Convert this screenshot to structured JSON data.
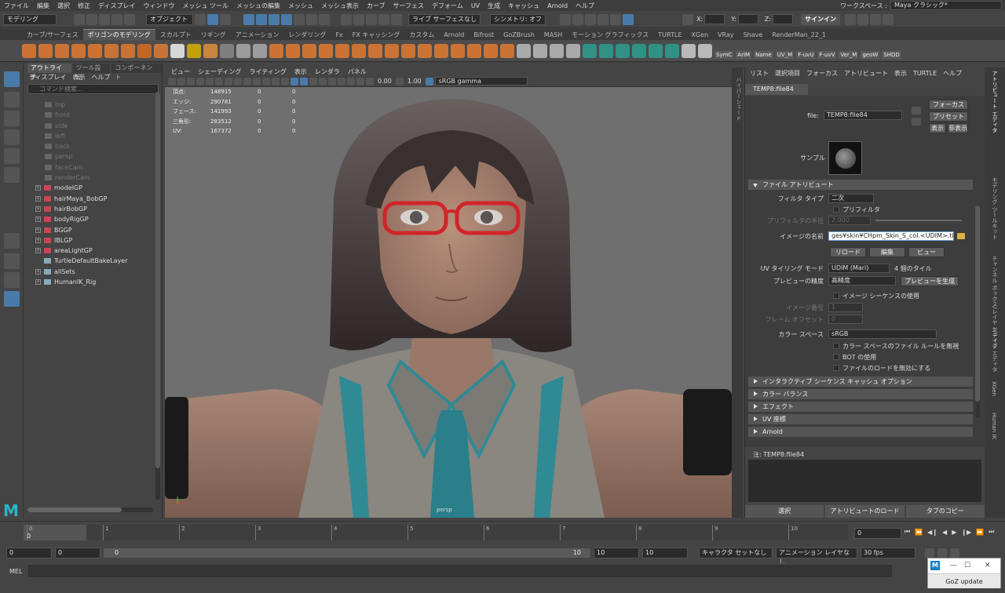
{
  "menubar": {
    "items": [
      "ファイル",
      "編集",
      "選択",
      "修正",
      "ディスプレイ",
      "ウィンドウ",
      "メッシュ ツール",
      "メッシュの編集",
      "メッシュ",
      "メッシュ表示",
      "カーブ",
      "サーフェス",
      "デフォーム",
      "UV",
      "生成",
      "キャッシュ",
      "Arnold",
      "ヘルプ"
    ],
    "workspace_label": "ワークスペース :",
    "workspace_value": "Maya クラシック*"
  },
  "status": {
    "mode": "モデリング",
    "object_label": "オブジェクト",
    "surface_label": "ライブ サーフェスなし",
    "symmetry_label": "シンメトリ: オフ",
    "x_label": "X:",
    "y_label": "Y:",
    "z_label": "Z:",
    "signin": "サインイン"
  },
  "shelf": {
    "tabs": [
      "カーブ/サーフェス",
      "ポリゴンのモデリング",
      "スカルプト",
      "リギング",
      "アニメーション",
      "レンダリング",
      "Fx",
      "FX キャッシング",
      "カスタム",
      "Arnold",
      "Bifrost",
      "GoZBrush",
      "MASH",
      "モーション グラフィックス",
      "TURTLE",
      "XGen",
      "VRay",
      "Shave",
      "RenderMan_22_1"
    ],
    "active_tab": 1,
    "labels": [
      "SymC",
      "ArIM",
      "Name",
      "UV_M",
      "F-uvU",
      "F-uvV",
      "Ver_M",
      "geoW",
      "SHDD"
    ]
  },
  "outliner": {
    "tabs": [
      "アウトライナ",
      "ツール設定",
      "コンポーネント"
    ],
    "menu": [
      "ディスプレイ",
      "表示",
      "ヘルプ"
    ],
    "search_placeholder": "コマンド検索...",
    "cameras": [
      "top",
      "front",
      "side",
      "left",
      "back",
      "persp",
      "faceCam",
      "renderCam"
    ],
    "groups": [
      "modelGP",
      "hairMaya_BobGP",
      "hairBobGP",
      "bodyRigGP",
      "BGGP",
      "IBLGP",
      "areaLightGP",
      "TurtleDefaultBakeLayer",
      "allSets",
      "HumanIK_Rig"
    ]
  },
  "viewport": {
    "menu": [
      "ビュー",
      "シェーディング",
      "ライティング",
      "表示",
      "レンダラ",
      "パネル"
    ],
    "exposure": "0.00",
    "gamma": "1.00",
    "colorspace": "sRGB gamma",
    "hud": [
      {
        "k": "頂点:",
        "v": "148915",
        "a": "0",
        "b": "0"
      },
      {
        "k": "エッジ:",
        "v": "290781",
        "a": "0",
        "b": "0"
      },
      {
        "k": "フェース:",
        "v": "141993",
        "a": "0",
        "b": "0"
      },
      {
        "k": "三角形:",
        "v": "283512",
        "a": "0",
        "b": "0"
      },
      {
        "k": "UV:",
        "v": "167372",
        "a": "0",
        "b": "0"
      }
    ],
    "camera_label": "persp"
  },
  "hypershade_tab": "ハイパーシェード",
  "attr_editor": {
    "menu": [
      "リスト",
      "選択項目",
      "フォーカス",
      "アトリビュート",
      "表示",
      "TURTLE",
      "ヘルプ"
    ],
    "node_tab": "TEMP8:file84",
    "file_label": "file:",
    "file_value": "TEMP8:file84",
    "focus_btn": "フォーカス",
    "preset_btn": "プリセット",
    "show_btn": "表示",
    "hide_btn": "非表示",
    "sample_label": "サンプル",
    "file_attr_section": "ファイル アトリビュート",
    "filter_type_label": "フィルタ タイプ",
    "filter_type_value": "二次",
    "prefilter_label": "プリフィルタ",
    "prefilter_radius_label": "プリフィルタの半径",
    "prefilter_radius_value": "2.000",
    "image_name_label": "イメージの名前",
    "image_name_value": "ges¥skin¥CHpm_Skin_S_col.<UDIM>.tif",
    "reload_btn": "リロード",
    "edit_btn": "編集",
    "view_btn": "ビュー",
    "uv_tiling_label": "UV タイリング モード",
    "uv_tiling_value": "UDIM (Mari)",
    "tiles_count": "4 個のタイル",
    "preview_quality_label": "プレビューの精度",
    "preview_quality_value": "高精度",
    "gen_preview_btn": "プレビューを生成",
    "use_sequence_label": "イメージ シーケンスの使用",
    "image_number_label": "イメージ番号",
    "image_number_value": "1",
    "frame_offset_label": "フレーム オフセット",
    "frame_offset_value": "0",
    "colorspace_label": "カラー スペース",
    "colorspace_value": "sRGB",
    "ignore_rules_label": "カラー スペースのファイル ルールを無視",
    "use_bot_label": "BOT の使用",
    "disable_load_label": "ファイルのロードを無効にする",
    "sections": [
      "インタラクティブ シーケンス キャッシュ オプション",
      "カラー バランス",
      "エフェクト",
      "UV 座標",
      "Arnold"
    ],
    "notes_label": "注:  TEMP8:file84",
    "bottom_buttons": [
      "選択",
      "アトリビュートのロード",
      "タブのコピー"
    ]
  },
  "right_tabs": [
    "アトリビュート エディタ",
    "モデリング ツールキット",
    "チャンネル ボックス/レイヤ エディタ",
    "シェイプ エディタ",
    "XGen",
    "Human IK"
  ],
  "timeline": {
    "ticks": [
      "0",
      "1",
      "2",
      "3",
      "4",
      "5",
      "6",
      "7",
      "8",
      "9",
      "10"
    ],
    "current": "0",
    "end_field": "0"
  },
  "range": {
    "start": "0",
    "anim_start": "0",
    "slider_start": "0",
    "slider_end": "10",
    "anim_end": "10",
    "end": "10",
    "character_set": "キャラクタ セットなし",
    "anim_layer": "アニメーション レイヤなし",
    "fps": "30 fps"
  },
  "mel": {
    "label": "MEL"
  },
  "goz": {
    "title": "GoZ update"
  },
  "colors": {
    "accent": "#4a7ba8",
    "maya_logo": "#2bb5c7"
  }
}
